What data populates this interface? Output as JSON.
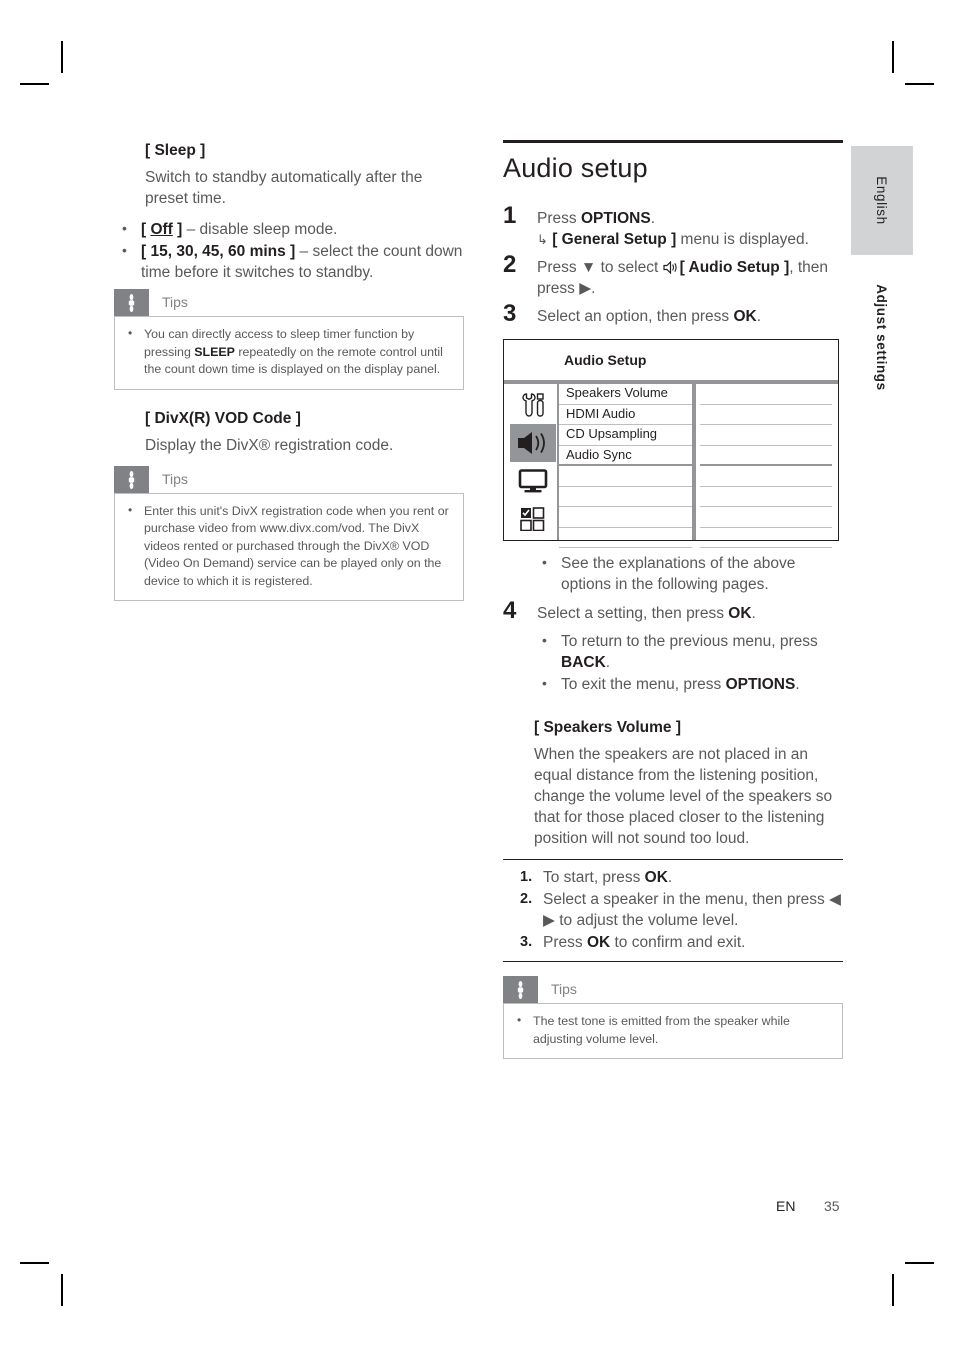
{
  "page": {
    "language_tab": "English",
    "chapter_tab": "Adjust settings",
    "footer_lang": "EN",
    "footer_page": "35"
  },
  "left_column": {
    "sleep": {
      "heading": "[ Sleep ]",
      "body": "Switch to standby automatically after the preset time.",
      "bullets": [
        {
          "pre": "[ ",
          "value": "Off",
          "post": " ]",
          "rest": " – disable sleep mode."
        },
        {
          "pre": "[ ",
          "value": "15, 30, 45, 60 mins",
          "post": " ]",
          "rest": " – select the count down time before it switches to standby."
        }
      ],
      "tips": {
        "label": "Tips",
        "items": [
          {
            "part1": "You can directly access to sleep timer function by pressing ",
            "bold": "SLEEP",
            "part2": " repeatedly on the remote control until the count down time is displayed on the display panel."
          }
        ]
      }
    },
    "divx": {
      "heading": "[ DivX(R) VOD Code ]",
      "body": "Display the DivX® registration code.",
      "tips": {
        "label": "Tips",
        "items": [
          {
            "part1": "Enter this unit's DivX registration code when you rent or purchase video from www.divx.com/vod. The DivX videos rented or purchased through the DivX® VOD (Video On Demand) service can be played only on the device to which it is registered.",
            "bold": "",
            "part2": ""
          }
        ]
      }
    }
  },
  "right_column": {
    "section_title": "Audio setup",
    "steps": [
      {
        "num": "1",
        "pre": "Press ",
        "bold": "OPTIONS",
        "post": ".",
        "result_pre": "",
        "result_bold": "[ General Setup ]",
        "result_post": " menu is displayed."
      },
      {
        "num": "2",
        "pre": "Press ▼ to select ",
        "bold": "[ Audio Setup ]",
        "post": ", then press ▶.",
        "result_pre": "",
        "result_bold": "",
        "result_post": ""
      },
      {
        "num": "3",
        "pre": "Select an option, then press ",
        "bold": "OK",
        "post": ".",
        "result_pre": "",
        "result_bold": "",
        "result_post": ""
      }
    ],
    "osd": {
      "title": "Audio Setup",
      "icons": [
        "tools-icon",
        "speaker-icon",
        "monitor-icon",
        "preference-grid-icon"
      ],
      "active_icon_index": 1,
      "rows": [
        "Speakers Volume",
        "HDMI Audio",
        "CD Upsampling",
        "Audio Sync",
        "",
        "",
        "",
        ""
      ]
    },
    "osd_note": "See the explanations of the above options in the following pages.",
    "step4": {
      "num": "4",
      "pre": "Select a setting, then press ",
      "bold": "OK",
      "post": ".",
      "bullets": [
        {
          "pre": "To return to the previous menu, press ",
          "bold": "BACK",
          "post": "."
        },
        {
          "pre": "To exit the menu, press ",
          "bold": "OPTIONS",
          "post": "."
        }
      ]
    },
    "speakers_volume": {
      "heading": "[ Speakers Volume ]",
      "body": "When the speakers are not placed in an equal distance from the listening position, change the volume level of the speakers so that for those placed closer to the listening position will not sound too loud.",
      "procedure": [
        {
          "num": "1.",
          "pre": "To start, press ",
          "bold": "OK",
          "post": "."
        },
        {
          "num": "2.",
          "pre": "Select a speaker in the menu, then press ◀ ▶ to adjust the volume level.",
          "bold": "",
          "post": ""
        },
        {
          "num": "3.",
          "pre": "Press ",
          "bold": "OK",
          "post": " to confirm and exit."
        }
      ],
      "tips": {
        "label": "Tips",
        "items": [
          {
            "part1": "The test tone is emitted from the speaker while adjusting volume level.",
            "bold": "",
            "part2": ""
          }
        ]
      }
    }
  }
}
